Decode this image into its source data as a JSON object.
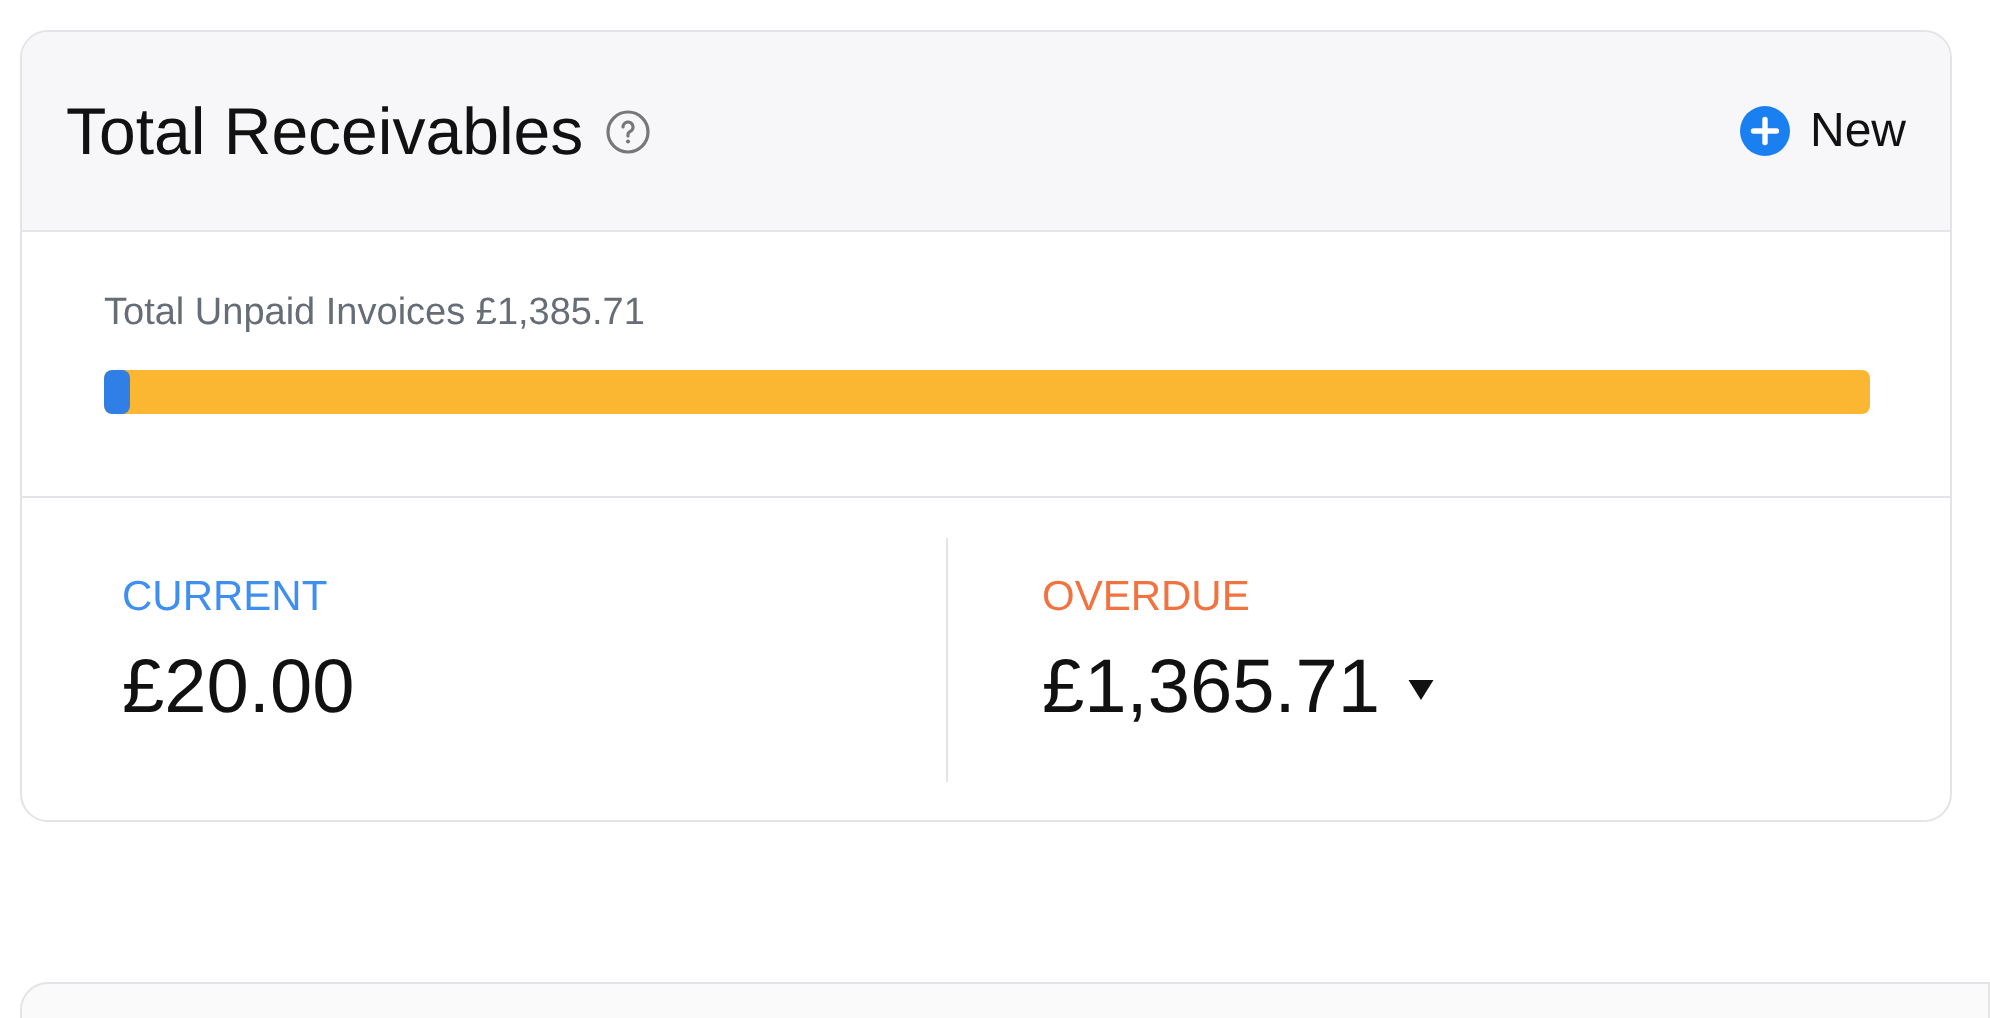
{
  "card": {
    "title": "Total Receivables",
    "new_button": "New",
    "unpaid_label": "Total Unpaid Invoices £1,385.71",
    "bar": {
      "level": 0.0144
    },
    "columns": [
      {
        "kind": "current",
        "label": "CURRENT",
        "amount": "£20.00",
        "dropdown": false
      },
      {
        "kind": "overdue",
        "label": "OVERDUE",
        "amount": "£1,365.71",
        "dropdown": true
      }
    ]
  }
}
